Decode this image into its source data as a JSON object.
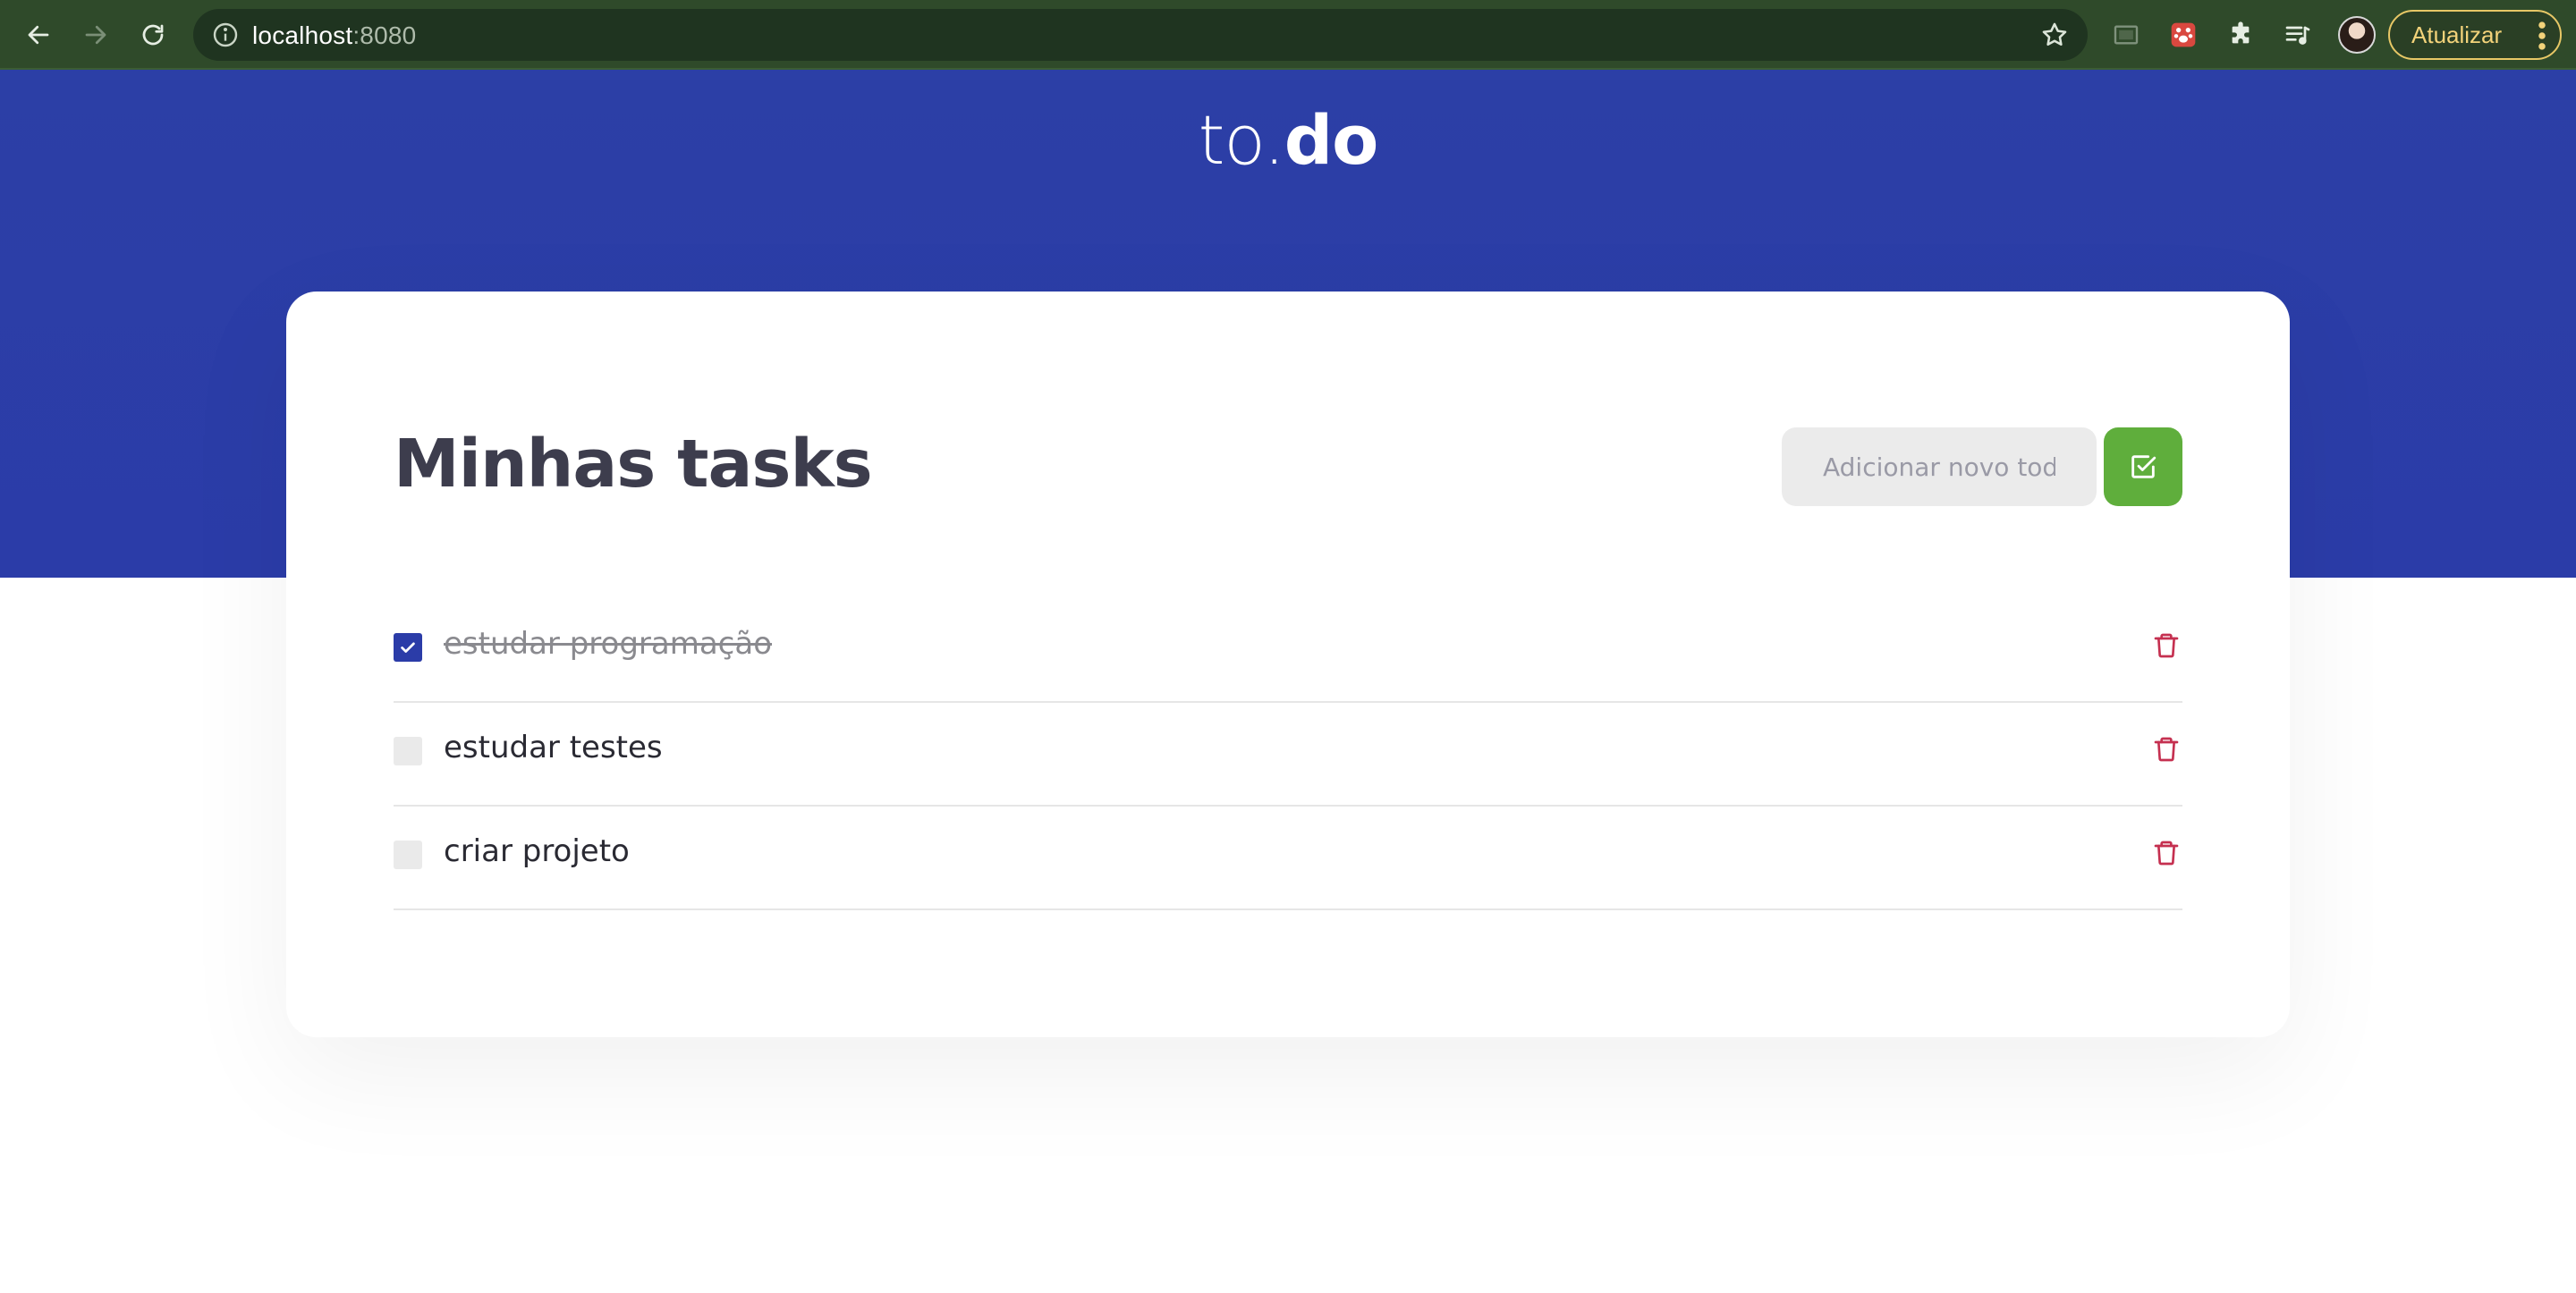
{
  "browser": {
    "url_host": "localhost",
    "url_port": ":8080",
    "update_label": "Atualizar",
    "icons": [
      "back-arrow-icon",
      "forward-arrow-icon",
      "reload-icon",
      "info-icon",
      "star-icon",
      "screen-cast-icon",
      "extension-paw-icon",
      "puzzle-extensions-icon",
      "media-queue-icon",
      "kebab-menu-icon"
    ]
  },
  "app": {
    "logo_light": "to.",
    "logo_bold": "do",
    "page_title": "Minhas tasks",
    "new_todo_placeholder": "Adicionar novo todo",
    "colors": {
      "header": "#2b3ca8",
      "add_button": "#5fae3c",
      "checked": "#2b3ca8",
      "trash": "#c53050",
      "title_text": "#3d3d4d"
    },
    "tasks": [
      {
        "title": "estudar programação",
        "done": true
      },
      {
        "title": "estudar testes",
        "done": false
      },
      {
        "title": "criar projeto",
        "done": false
      }
    ]
  }
}
